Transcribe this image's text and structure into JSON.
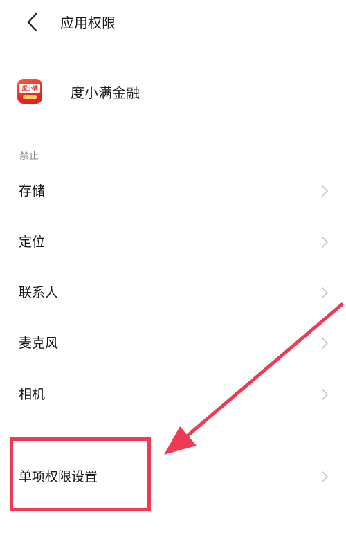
{
  "header": {
    "title": "应用权限"
  },
  "app": {
    "name": "度小满金融",
    "icon_text": "度小满"
  },
  "section": {
    "label": "禁止"
  },
  "permissions": [
    {
      "label": "存储"
    },
    {
      "label": "定位"
    },
    {
      "label": "联系人"
    },
    {
      "label": "麦克风"
    },
    {
      "label": "相机"
    }
  ],
  "single_setting": {
    "label": "单项权限设置"
  },
  "colors": {
    "highlight": "#ee3a52",
    "chevron": "#c8c8c8",
    "app_icon": "#e52a26"
  },
  "icons": {
    "back": "back-arrow-icon",
    "chevron": "chevron-right-icon",
    "annotation": "red-arrow-annotation"
  }
}
